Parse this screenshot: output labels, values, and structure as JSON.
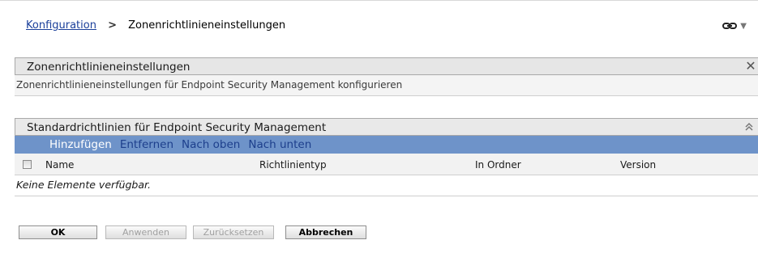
{
  "breadcrumb": {
    "parent": "Konfiguration",
    "separator": ">",
    "current": "Zonenrichtlinieneinstellungen"
  },
  "header_icons": {
    "link_icon": "link-icon",
    "dropdown_icon": "▼"
  },
  "settings_panel": {
    "title": "Zonenrichtlinieneinstellungen",
    "close_glyph": "✕",
    "description": "Zonenrichtlinieneinstellungen für Endpoint Security Management konfigurieren"
  },
  "policies_panel": {
    "title": "Standardrichtlinien für Endpoint Security Management",
    "collapse_icon": "double-chevron-up-icon",
    "toolbar": {
      "add": "Hinzufügen",
      "remove": "Entfernen",
      "move_up": "Nach oben",
      "move_down": "Nach unten"
    },
    "columns": [
      "Name",
      "Richtlinientyp",
      "In Ordner",
      "Version"
    ],
    "empty_message": "Keine Elemente verfügbar."
  },
  "buttons": {
    "ok": "OK",
    "apply": "Anwenden",
    "reset": "Zurücksetzen",
    "cancel": "Abbrechen"
  },
  "colors": {
    "toolbar_bg": "#6e93c9",
    "link": "#1a3f9a",
    "toolbar_enabled_text": "#ffffff",
    "toolbar_disabled_text": "#1d3f8c"
  }
}
